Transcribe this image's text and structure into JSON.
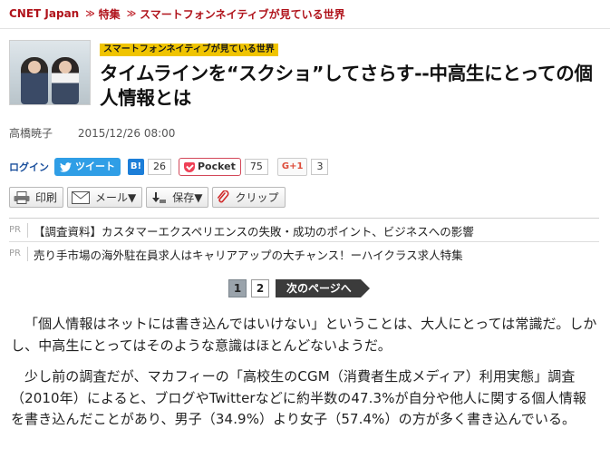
{
  "breadcrumb": {
    "items": [
      "CNET Japan",
      "特集",
      "スマートフォンネイティブが見ている世界"
    ],
    "separator": "≫"
  },
  "article": {
    "series_tag": "スマートフォンネイティブが見ている世界",
    "title": "タイムラインを“スクショ”してさらす--中高生にとっての個人情報とは",
    "author": "高橋暁子",
    "date": "2015/12/26 08:00"
  },
  "social": {
    "login_label": "ログイン",
    "tweet_label": "ツイート",
    "hatena_label": "B!",
    "hatena_count": "26",
    "pocket_label": "Pocket",
    "pocket_count": "75",
    "gplus_label": "G+1",
    "gplus_count": "3"
  },
  "tools": {
    "print_label": "印刷",
    "mail_label": "メール▼",
    "save_label": "保存▼",
    "clip_label": "クリップ"
  },
  "pr": {
    "mark": "PR",
    "items": [
      "【調査資料】カスタマーエクスペリエンスの失敗・成功のポイント、ビジネスへの影響",
      "売り手市場の海外駐在員求人はキャリアアップの大チャンス！ーハイクラス求人特集"
    ]
  },
  "pager": {
    "pages": [
      "1",
      "2"
    ],
    "current": "1",
    "next_label": "次のページへ"
  },
  "body": {
    "paragraphs": [
      "「個人情報はネットには書き込んではいけない」ということは、大人にとっては常識だ。しかし、中高生にとってはそのような意識はほとんどないようだ。",
      "少し前の調査だが、マカフィーの「高校生のCGM（消費者生成メディア）利用実態」調査（2010年）によると、ブログやTwitterなどに約半数の47.3%が自分や他人に関する個人情報を書き込んだことがあり、男子（34.9%）より女子（57.4%）の方が多く書き込んでいる。"
    ]
  },
  "colors": {
    "brand_red": "#b0131b",
    "tag_yellow": "#f0c400",
    "twitter_blue": "#2f9ee6",
    "hatena_blue": "#1c7ed8",
    "pocket_red": "#ee4056",
    "gplus_red": "#dd4b39",
    "next_button": "#3b3b3b"
  }
}
